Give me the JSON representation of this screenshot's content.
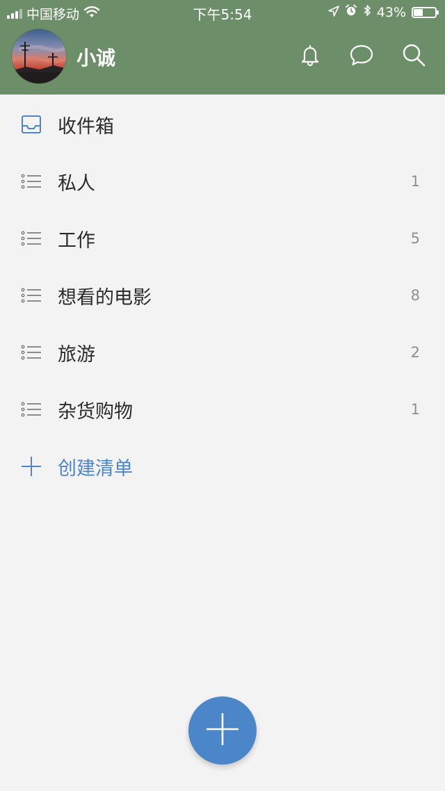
{
  "status_bar": {
    "carrier": "中国移动",
    "time": "下午5:54",
    "battery": "43%",
    "battery_level": 0.43
  },
  "header": {
    "username": "小诚",
    "icons": [
      "bell-icon",
      "chat-bubble-icon",
      "search-icon"
    ]
  },
  "lists": {
    "inbox": {
      "label": "收件箱",
      "icon": "inbox-icon"
    },
    "items": [
      {
        "label": "私人",
        "count": "1",
        "icon": "list-icon"
      },
      {
        "label": "工作",
        "count": "5",
        "icon": "list-icon"
      },
      {
        "label": "想看的电影",
        "count": "8",
        "icon": "list-icon"
      },
      {
        "label": "旅游",
        "count": "2",
        "icon": "list-icon"
      },
      {
        "label": "杂货购物",
        "count": "1",
        "icon": "list-icon"
      }
    ],
    "create": {
      "label": "创建清单",
      "icon": "plus-icon"
    }
  },
  "fab": {
    "icon": "plus-icon"
  },
  "colors": {
    "header_bg": "#6c8e68",
    "accent": "#4a86c8",
    "background": "#f4f3f3"
  }
}
